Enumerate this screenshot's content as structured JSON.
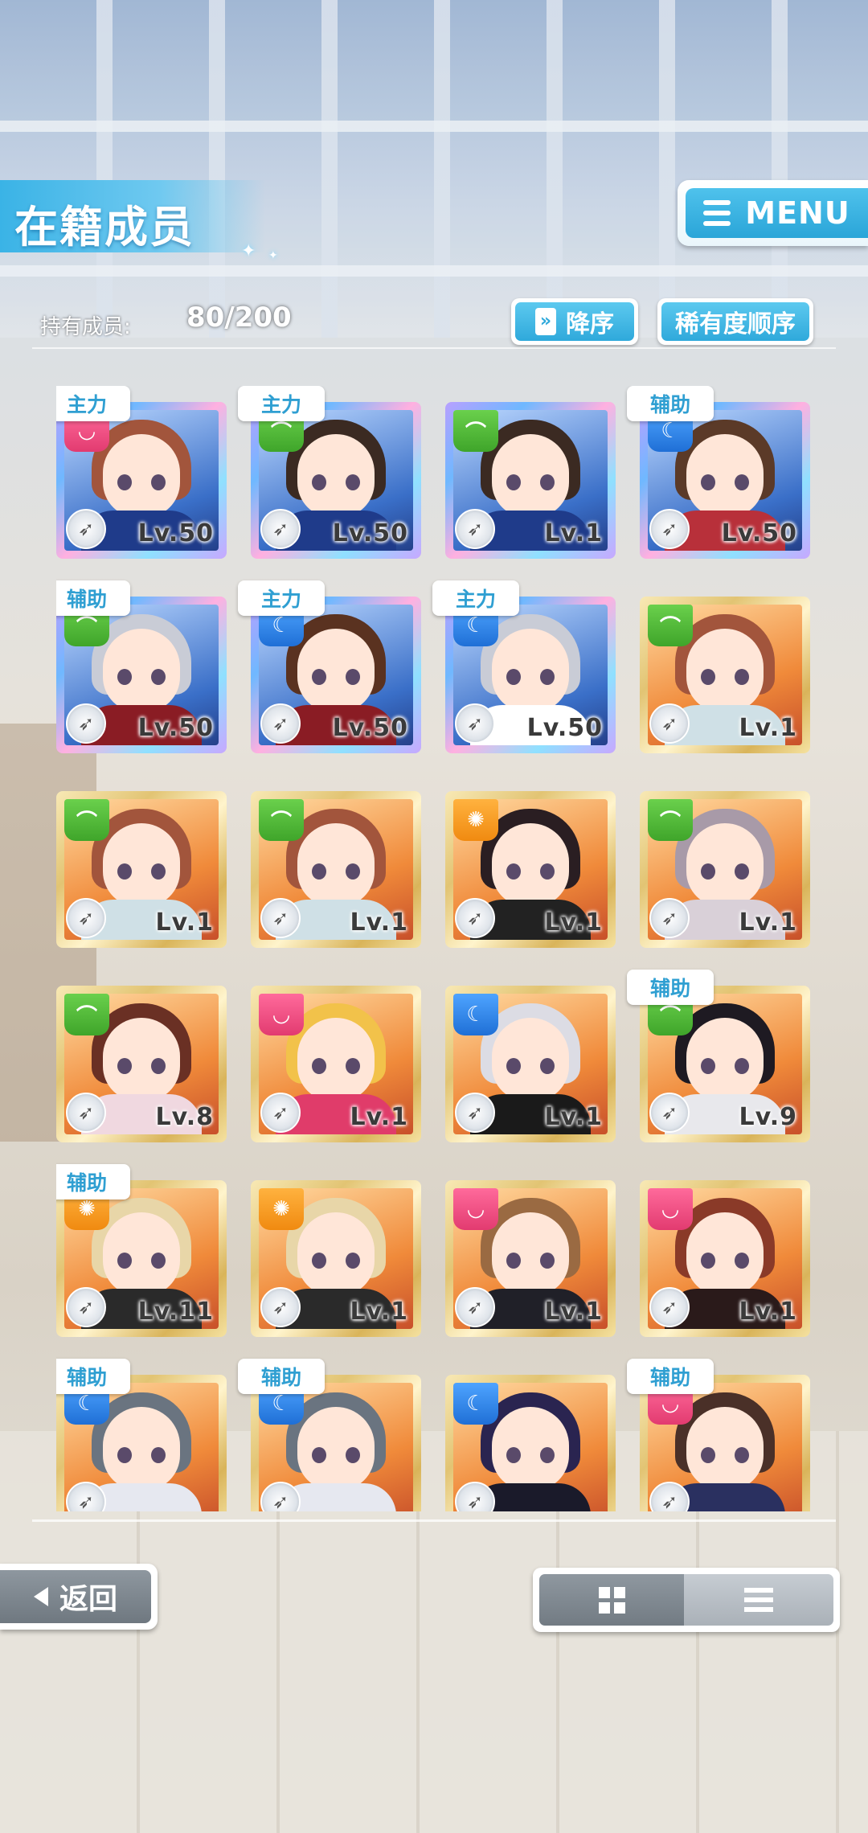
{
  "header": {
    "title": "在籍成员",
    "menu_label": "MENU",
    "owned_label": "持有成员:",
    "owned_value": "80/200",
    "sort_order_label": "降序",
    "sort_key_label": "稀有度顺序"
  },
  "cards": [
    {
      "role": "主力",
      "level": "Lv.50",
      "frame": "rainbow",
      "attr": "pink",
      "hair": "#a2553c",
      "body": "#1f3b8a"
    },
    {
      "role": "主力",
      "level": "Lv.50",
      "frame": "rainbow",
      "attr": "green",
      "hair": "#3b2a22",
      "body": "#1f3b8a"
    },
    {
      "role": "",
      "level": "Lv.1",
      "frame": "rainbow",
      "attr": "green",
      "hair": "#3b2a22",
      "body": "#1f3b8a"
    },
    {
      "role": "辅助",
      "level": "Lv.50",
      "frame": "rainbow",
      "attr": "blue",
      "hair": "#5b3a28",
      "body": "#b8303a"
    },
    {
      "role": "辅助",
      "level": "Lv.50",
      "frame": "rainbow",
      "attr": "green",
      "hair": "#c9ccd6",
      "body": "#8a1c24"
    },
    {
      "role": "主力",
      "level": "Lv.50",
      "frame": "rainbow",
      "attr": "blue",
      "hair": "#5a3220",
      "body": "#8a1c24"
    },
    {
      "role": "主力",
      "level": "Lv.50",
      "frame": "rainbow",
      "attr": "blue",
      "hair": "#c9ccd6",
      "body": "#ffffff"
    },
    {
      "role": "",
      "level": "Lv.1",
      "frame": "gold",
      "attr": "green",
      "hair": "#a2553c",
      "body": "#cfe0e6"
    },
    {
      "role": "",
      "level": "Lv.1",
      "frame": "gold",
      "attr": "green",
      "hair": "#a2553c",
      "body": "#cfe0e6"
    },
    {
      "role": "",
      "level": "Lv.1",
      "frame": "gold",
      "attr": "green",
      "hair": "#a2553c",
      "body": "#cfe0e6"
    },
    {
      "role": "",
      "level": "Lv.1",
      "frame": "gold",
      "attr": "orange",
      "hair": "#2a1e22",
      "body": "#222222"
    },
    {
      "role": "",
      "level": "Lv.1",
      "frame": "gold",
      "attr": "green",
      "hair": "#a89aa8",
      "body": "#d9d0d8"
    },
    {
      "role": "",
      "level": "Lv.8",
      "frame": "gold",
      "attr": "green",
      "hair": "#6a3024",
      "body": "#f0d8e0"
    },
    {
      "role": "",
      "level": "Lv.1",
      "frame": "gold",
      "attr": "pink",
      "hair": "#f2c24a",
      "body": "#e03c6a"
    },
    {
      "role": "",
      "level": "Lv.1",
      "frame": "gold",
      "attr": "blue",
      "hair": "#dcdce4",
      "body": "#1a1a1a"
    },
    {
      "role": "辅助",
      "level": "Lv.9",
      "frame": "gold",
      "attr": "green",
      "hair": "#1e1a22",
      "body": "#e8e8ec"
    },
    {
      "role": "辅助",
      "level": "Lv.11",
      "frame": "gold",
      "attr": "orange",
      "hair": "#e8d6a8",
      "body": "#2a2a2a"
    },
    {
      "role": "",
      "level": "Lv.1",
      "frame": "gold",
      "attr": "orange",
      "hair": "#e8d6a8",
      "body": "#2a2a2a"
    },
    {
      "role": "",
      "level": "Lv.1",
      "frame": "gold",
      "attr": "pink",
      "hair": "#9a6a42",
      "body": "#202028"
    },
    {
      "role": "",
      "level": "Lv.1",
      "frame": "gold",
      "attr": "pink",
      "hair": "#8a3a28",
      "body": "#2a1a1a"
    },
    {
      "role": "辅助",
      "level": "",
      "frame": "gold",
      "attr": "blue",
      "hair": "#6a7480",
      "body": "#e6e8f0"
    },
    {
      "role": "辅助",
      "level": "",
      "frame": "gold",
      "attr": "blue",
      "hair": "#6a7480",
      "body": "#e6e8f0"
    },
    {
      "role": "",
      "level": "",
      "frame": "gold",
      "attr": "blue",
      "hair": "#2a2450",
      "body": "#1a1a2a"
    },
    {
      "role": "辅助",
      "level": "",
      "frame": "gold",
      "attr": "pink",
      "hair": "#4a3028",
      "body": "#2a3060"
    }
  ],
  "footer": {
    "back_label": "返回",
    "view_grid_icon": "grid-view-icon",
    "view_list_icon": "list-view-icon"
  },
  "colors": {
    "accent": "#2fa9db",
    "attr_green": "#3fa52a",
    "attr_orange": "#f08a10",
    "attr_blue": "#1f6fd6",
    "attr_pink": "#e23b70"
  }
}
